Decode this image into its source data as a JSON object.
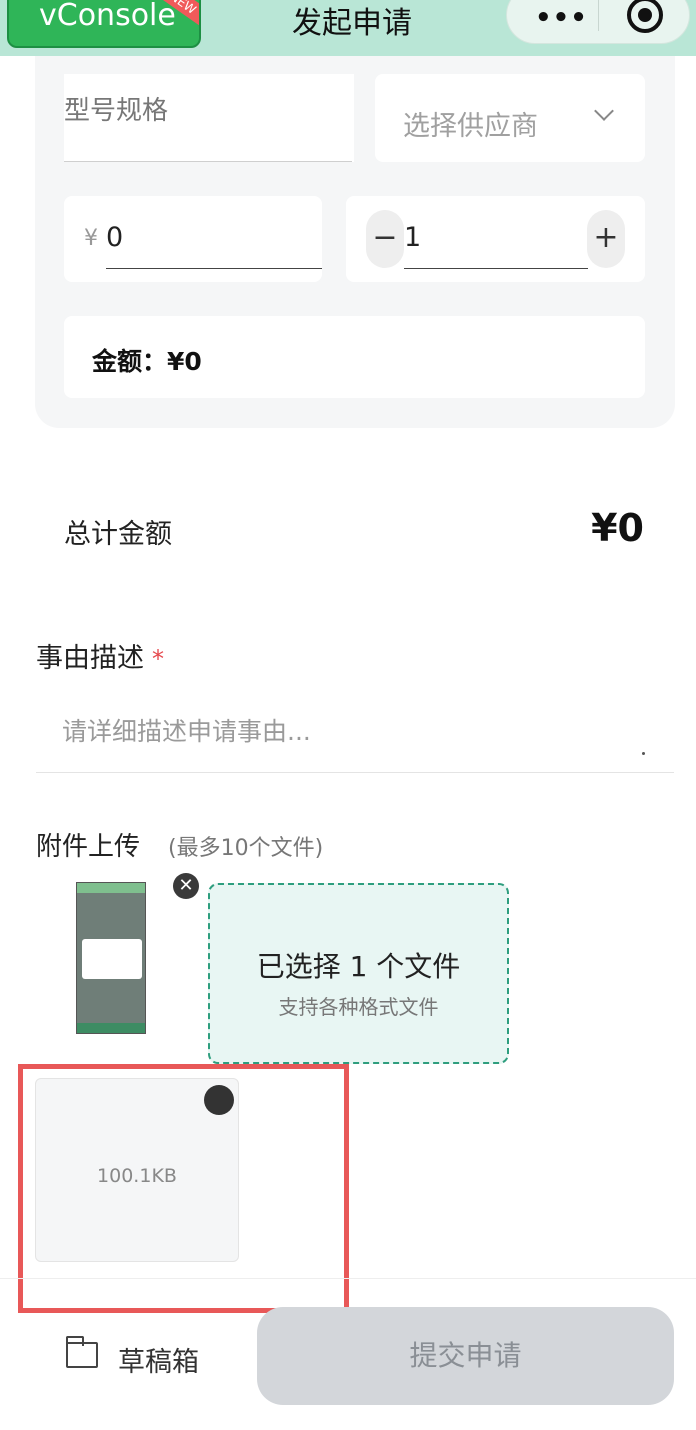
{
  "nav": {
    "vconsole_label": "vConsole",
    "vconsole_badge": "NEW",
    "title": "发起申请",
    "more_icon": "•••",
    "target_icon": "record-icon"
  },
  "item": {
    "model_label": "型号规格",
    "supplier_placeholder": "选择供应商",
    "price_currency": "¥",
    "price_value": "0",
    "qty_minus": "−",
    "qty_value": "1",
    "qty_plus": "+",
    "amount_text": "金额：¥0"
  },
  "total": {
    "label": "总计金额",
    "value": "¥0"
  },
  "reason": {
    "label": "事由描述",
    "required_mark": "*",
    "placeholder": "请详细描述申请事由..."
  },
  "attachments": {
    "label": "附件上传",
    "hint": "(最多10个文件)",
    "remove_symbol": "✕",
    "upload_main": "已选择 1 个文件",
    "upload_sub": "支持各种格式文件",
    "file_size": "100.1KB"
  },
  "footer": {
    "draft_label": "草稿箱",
    "submit_label": "提交申请"
  },
  "colors": {
    "nav_bg": "#b9e6d6",
    "vconsole_green": "#2fb558",
    "upload_border": "#2e9e7e",
    "highlight_red": "#e85858",
    "submit_disabled_bg": "#d3d6da"
  }
}
